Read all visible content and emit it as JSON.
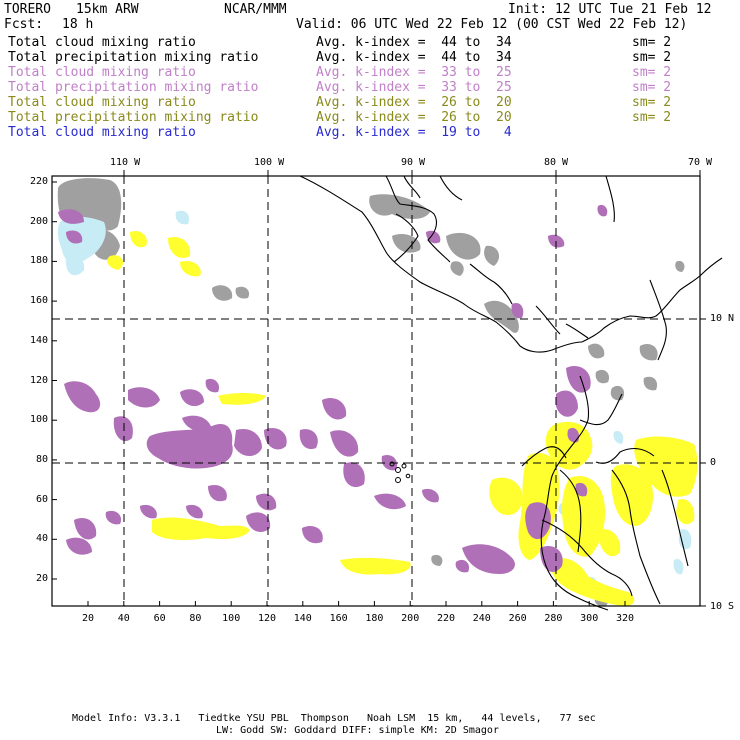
{
  "header": {
    "model": "TORERO",
    "resolution": "15km ARW",
    "org": "NCAR/MMM",
    "init": "Init: 12 UTC Tue 21 Feb 12",
    "fcst_label": "Fcst:",
    "fcst_value": "18 h",
    "valid": "Valid: 06 UTC Wed 22 Feb 12 (00 CST Wed 22 Feb 12)"
  },
  "legend": [
    {
      "field": "Total cloud mixing ratio",
      "range": "Avg. k-index =  44 to  34",
      "smooth": "sm= 2",
      "color": "#000000"
    },
    {
      "field": "Total precipitation mixing ratio",
      "range": "Avg. k-index =  44 to  34",
      "smooth": "sm= 2",
      "color": "#000000"
    },
    {
      "field": "Total cloud mixing ratio",
      "range": "Avg. k-index =  33 to  25",
      "smooth": "sm= 2",
      "color": "#c080c8"
    },
    {
      "field": "Total precipitation mixing ratio",
      "range": "Avg. k-index =  33 to  25",
      "smooth": "sm= 2",
      "color": "#c080c8"
    },
    {
      "field": "Total cloud mixing ratio",
      "range": "Avg. k-index =  26 to  20",
      "smooth": "sm= 2",
      "color": "#8a8a1c"
    },
    {
      "field": "Total precipitation mixing ratio",
      "range": "Avg. k-index =  26 to  20",
      "smooth": "sm= 2",
      "color": "#8a8a1c"
    },
    {
      "field": "Total cloud mixing ratio",
      "range": "Avg. k-index =  19 to   4",
      "smooth": "",
      "color": "#2a2ad0"
    }
  ],
  "map": {
    "longitude_labels": [
      "110 W",
      "100 W",
      "90 W",
      "80 W",
      "70 W"
    ],
    "latitude_labels": [
      "10 N",
      "0",
      "10 S"
    ],
    "y_grid_ticks": [
      "220",
      "200",
      "180",
      "160",
      "140",
      "120",
      "100",
      "80",
      "60",
      "40",
      "20"
    ],
    "x_grid_ticks": [
      "20",
      "40",
      "60",
      "80",
      "100",
      "120",
      "140",
      "160",
      "180",
      "200",
      "220",
      "240",
      "260",
      "280",
      "300",
      "320"
    ],
    "field_colors": {
      "gray": "#a0a0a0",
      "purple": "#b070b8",
      "yellow": "#ffff30",
      "lightblue": "#c8ecf6"
    }
  },
  "footer": {
    "line1": "Model Info: V3.3.1   Tiedtke YSU PBL  Thompson   Noah LSM  15 km,   44 levels,   77 sec",
    "line2": "LW: Godd SW: Goddard DIFF: simple KM: 2D Smagor"
  }
}
